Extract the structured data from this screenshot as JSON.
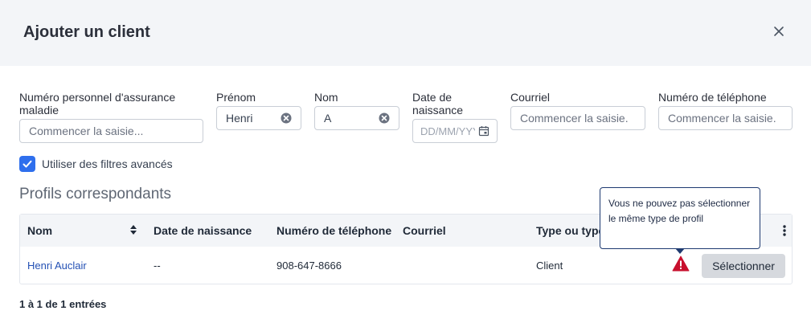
{
  "dialog": {
    "title": "Ajouter un client"
  },
  "filters": {
    "health_number": {
      "label": "Numéro personnel d'assurance maladie",
      "placeholder": "Commencer la saisie..."
    },
    "first_name": {
      "label": "Prénom",
      "value": "Henri"
    },
    "last_name": {
      "label": "Nom",
      "value": "A"
    },
    "birth_date": {
      "label": "Date de naissance",
      "placeholder": "DD/MM/YYYY"
    },
    "email": {
      "label": "Courriel",
      "placeholder": "Commencer la saisie."
    },
    "phone": {
      "label": "Numéro de téléphone",
      "placeholder": "Commencer la saisie."
    },
    "advanced": {
      "label": "Utiliser des filtres avancés",
      "checked": true
    }
  },
  "results": {
    "section_title": "Profils correspondants",
    "columns": [
      "Nom",
      "Date de naissance",
      "Numéro de téléphone",
      "Courriel",
      "Type ou type"
    ],
    "rows": [
      {
        "name": "Henri Auclair",
        "birth_date": "--",
        "phone": "908-647-8666",
        "email": "",
        "type": "Client",
        "action": "Sélectionner"
      }
    ],
    "tooltip": "Vous ne pouvez pas sélectionner le même type de profil",
    "pagination": "1 à 1 de 1 entrées"
  },
  "colors": {
    "accent": "#2f6fed",
    "warning": "#c8102e",
    "link": "#2350b4",
    "header_bg": "#f3f5f8"
  },
  "icons": [
    "close-icon",
    "clear-icon",
    "calendar-icon",
    "check-icon",
    "sort-icon",
    "kebab-icon",
    "warning-icon"
  ]
}
